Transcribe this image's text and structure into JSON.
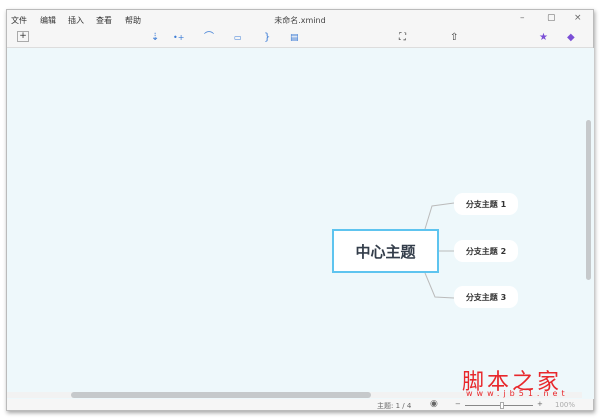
{
  "window": {
    "title": "未命名.xmind",
    "menu": [
      "文件",
      "编辑",
      "插入",
      "查看",
      "帮助"
    ],
    "controls": [
      "–",
      "▢",
      "×"
    ]
  },
  "toolbar": {
    "new_icon": "+",
    "icons": [
      "insert-subtopic-icon",
      "insert-topic-icon",
      "relationship-icon",
      "boundary-icon",
      "summary-icon",
      "notes-icon",
      "fullscreen-icon",
      "share-icon",
      "star-icon",
      "theme-icon"
    ]
  },
  "mindmap": {
    "central": "中心主题",
    "branches": [
      "分支主题 1",
      "分支主题 2",
      "分支主题 3"
    ]
  },
  "status": {
    "topic_count": "主题: 1 / 4",
    "zoom": "100%",
    "zoom_minus": "−",
    "zoom_plus": "+"
  },
  "watermark": {
    "text": "脚本之家",
    "url": "www.jb51.net"
  },
  "colors": {
    "accent": "#5ec4ef",
    "canvas": "#eef8fb"
  }
}
